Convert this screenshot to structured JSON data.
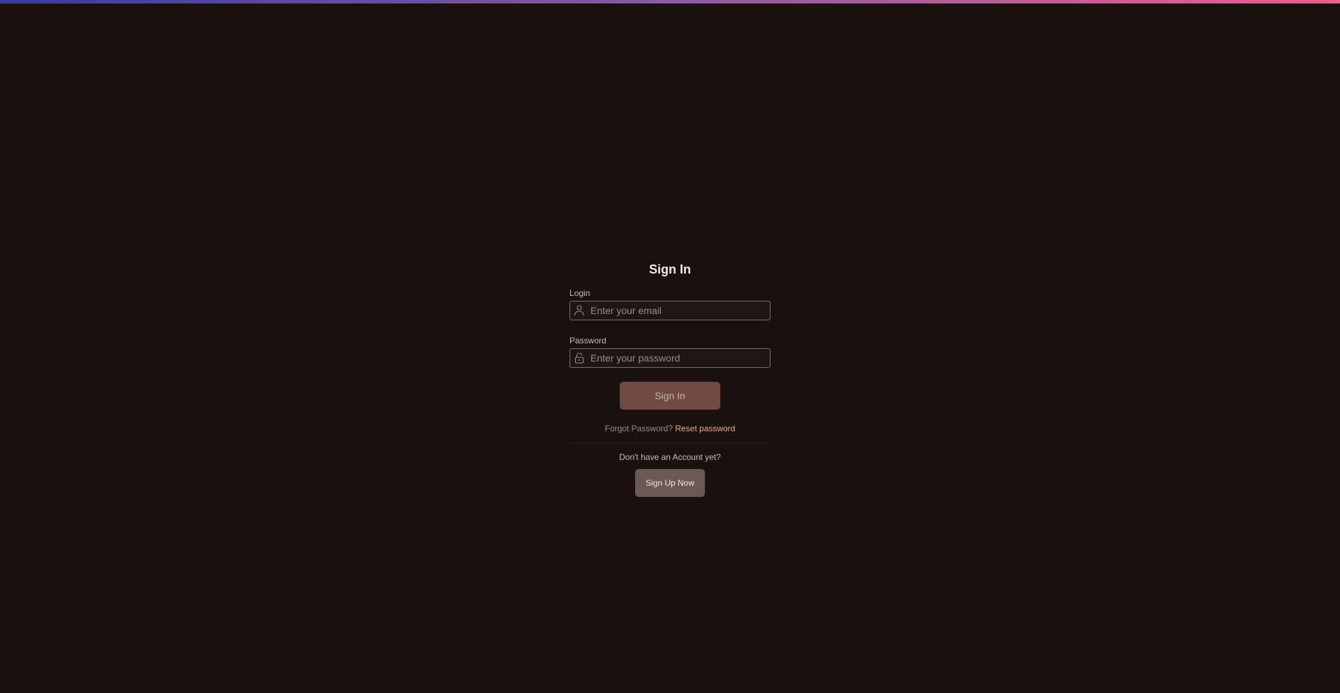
{
  "colors": {
    "background": "#1a110e",
    "accent_link": "#f3a68f",
    "primary_button": "#6f4a45",
    "secondary_button": "#6a5955",
    "top_gradient_start": "#3a3c9a",
    "top_gradient_end": "#e8608e"
  },
  "form": {
    "title": "Sign In",
    "login": {
      "label": "Login",
      "placeholder": "Enter your email",
      "value": "",
      "icon": "user-icon"
    },
    "password": {
      "label": "Password",
      "placeholder": "Enter your password",
      "value": "",
      "icon": "lock-icon"
    },
    "submit_label": "Sign In",
    "forgot_text": "Forgot Password?",
    "reset_link": "Reset password",
    "no_account_text": "Don't have an Account yet?",
    "signup_label": "Sign Up Now"
  }
}
